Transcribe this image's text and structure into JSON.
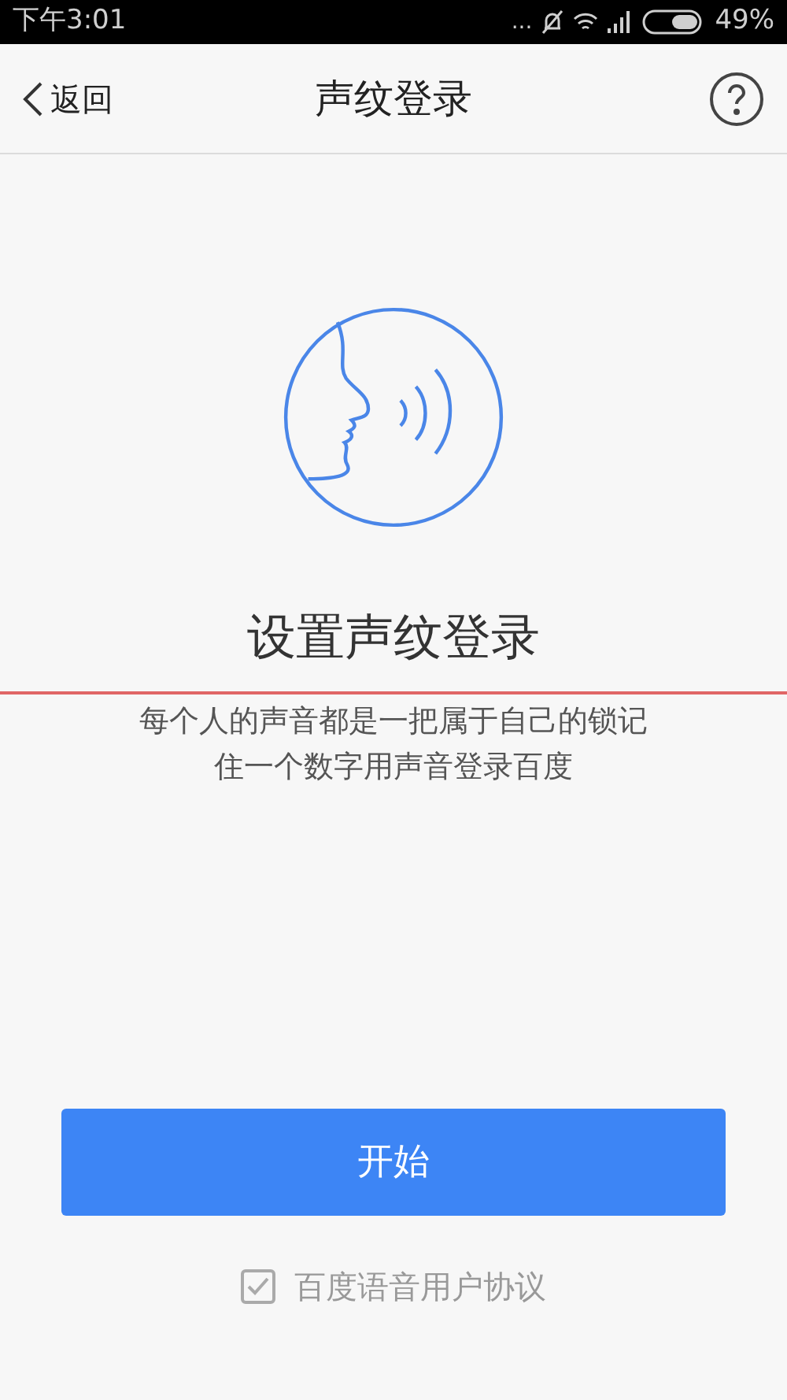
{
  "status_bar": {
    "time": "下午3:01",
    "dots": "...",
    "battery": "49%"
  },
  "header": {
    "back": "返回",
    "title": "声纹登录"
  },
  "heading": "设置声纹登录",
  "description": [
    "每个人的声音都是一把属于自己的锁记",
    "住一个数字用声音登录百度"
  ],
  "start_button": "开始",
  "agreement": {
    "label": "百度语音用户协议",
    "checked": true
  }
}
